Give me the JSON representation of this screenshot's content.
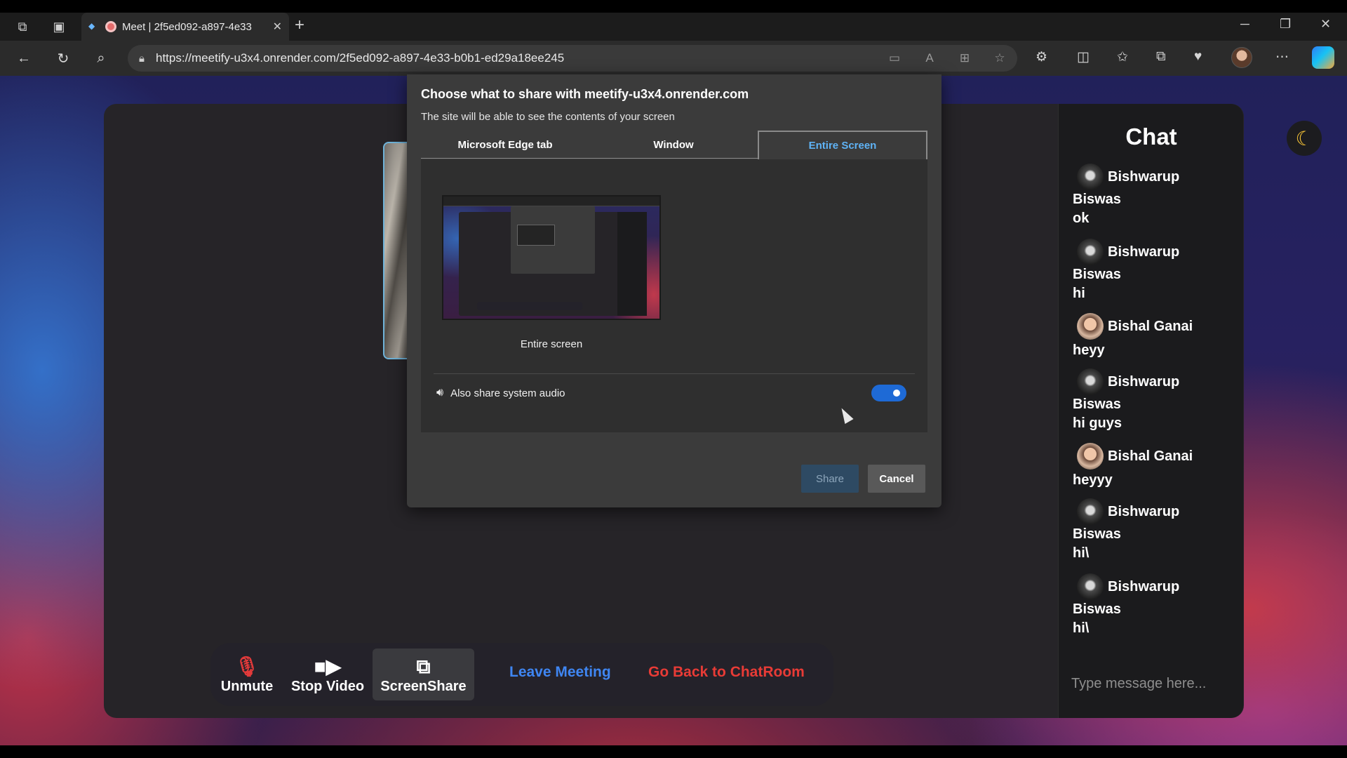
{
  "browser": {
    "tab_title": "Meet | 2f5ed092-a897-4e33",
    "url": "https://meetify-u3x4.onrender.com/2f5ed092-a897-4e33-b0b1-ed29a18ee245"
  },
  "dialog": {
    "title": "Choose what to share with meetify-u3x4.onrender.com",
    "subtitle": "The site will be able to see the contents of your screen",
    "tabs": [
      {
        "label": "Microsoft Edge tab"
      },
      {
        "label": "Window"
      },
      {
        "label": "Entire Screen",
        "selected": true
      }
    ],
    "thumbnail_label": "Entire screen",
    "audio_label": "Also share system audio",
    "audio_enabled": true,
    "share_label": "Share",
    "cancel_label": "Cancel"
  },
  "chat": {
    "title": "Chat",
    "messages": [
      {
        "first": "Bishwarup",
        "last": "Biswas",
        "text": "ok"
      },
      {
        "first": "Bishwarup",
        "last": "Biswas",
        "text": "hi"
      },
      {
        "first": "Bishal Ganai",
        "last": "",
        "text": "heyy"
      },
      {
        "first": "Bishwarup",
        "last": "Biswas",
        "text": "hi guys"
      },
      {
        "first": "Bishal Ganai",
        "last": "",
        "text": "heyyy"
      },
      {
        "first": "Bishwarup",
        "last": "Biswas",
        "text": "hi\\"
      },
      {
        "first": "Bishwarup",
        "last": "Biswas",
        "text": "hi\\"
      }
    ],
    "input_placeholder": "Type message here..."
  },
  "controls": {
    "unmute": "Unmute",
    "stop_video": "Stop Video",
    "screen_share": "ScreenShare",
    "leave": "Leave Meeting",
    "back": "Go Back to ChatRoom"
  },
  "colors": {
    "accent_blue": "#3f86f2",
    "danger_red": "#e83b36",
    "selected_tab": "#5fb3f6",
    "toggle_on": "#1e6ad6"
  },
  "icons": [
    "workspaces-icon",
    "tab-actions-icon",
    "recording-icon",
    "close-tab-icon",
    "new-tab-icon",
    "minimize-icon",
    "maximize-icon",
    "close-window-icon",
    "back-icon",
    "refresh-icon",
    "search-icon",
    "lock-icon",
    "camera-icon",
    "read-aloud-icon",
    "app-icon",
    "favorite-icon",
    "extensions-icon",
    "split-screen-icon",
    "favorites-icon",
    "collections-icon",
    "performance-icon",
    "profile-icon",
    "more-icon",
    "copilot-icon",
    "speaker-icon",
    "mic-off-icon",
    "video-icon",
    "screenshare-icon",
    "moon-icon"
  ]
}
